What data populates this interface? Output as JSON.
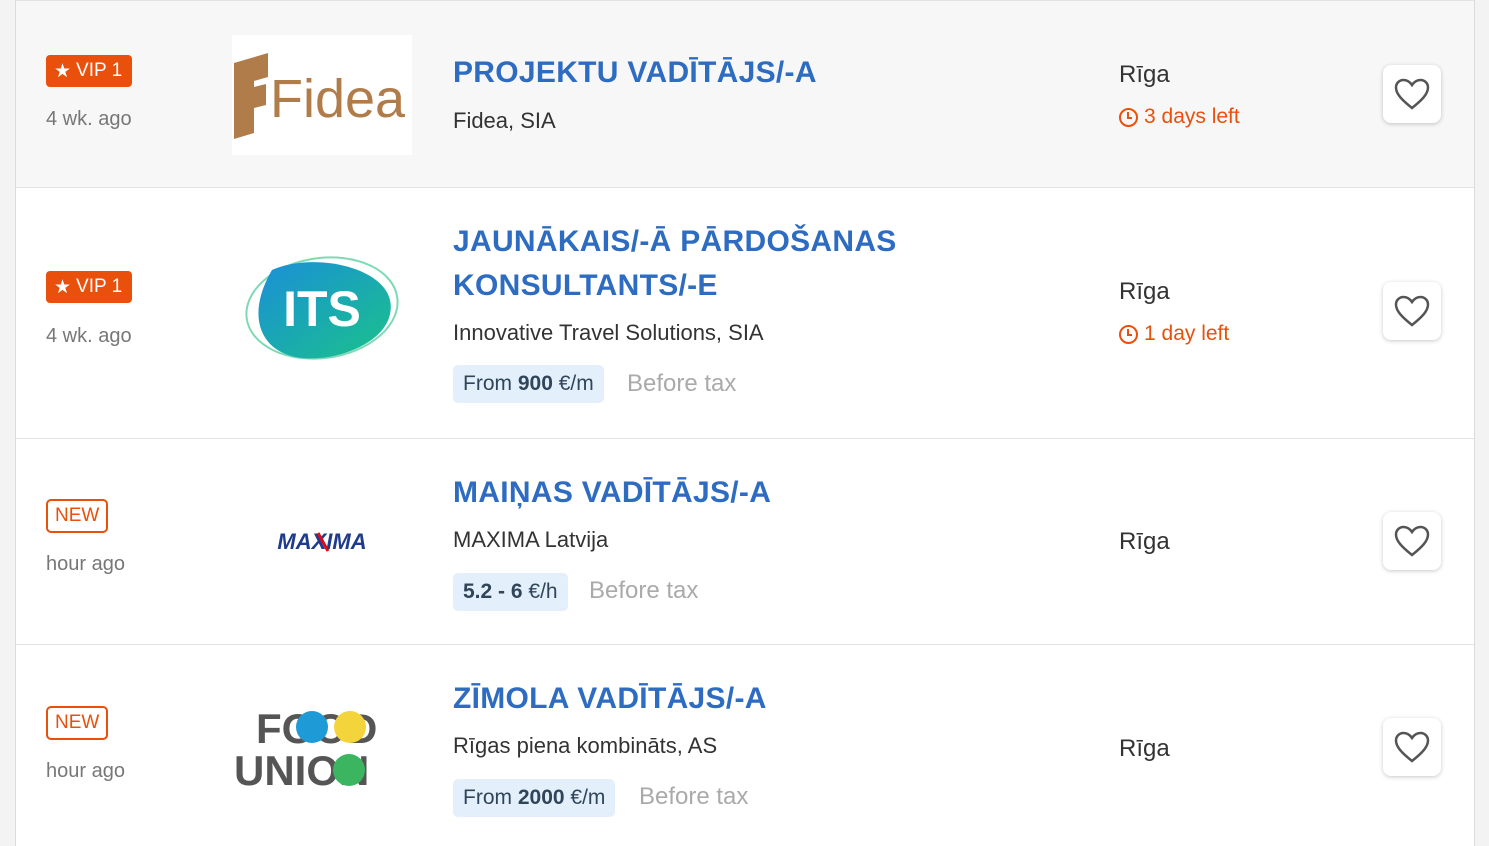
{
  "colors": {
    "accent": "#e8500c",
    "title": "#2d6cc0",
    "salary_bg": "#e3f0fb"
  },
  "jobs": [
    {
      "badge": "VIP 1",
      "badge_icon": "star-icon",
      "posted": "4 wk. ago",
      "logo_text": "Fidea",
      "title": "PROJEKTU VADĪTĀJS/-A",
      "company": "Fidea, SIA",
      "city": "Rīga",
      "deadline": "3 days left"
    },
    {
      "badge": "VIP 1",
      "badge_icon": "star-icon",
      "posted": "4 wk. ago",
      "logo_text": "ITS",
      "title": "JAUNĀKAIS/-Ā PĀRDOŠANAS KONSULTANTS/-E",
      "company": "Innovative Travel Solutions, SIA",
      "salary_prefix": "From",
      "salary_value": "900",
      "salary_unit": "€/m",
      "tax_note": "Before tax",
      "city": "Rīga",
      "deadline": "1 day left"
    },
    {
      "badge": "NEW",
      "posted": "hour ago",
      "logo_text": "MAXIMA",
      "title": "MAIŅAS VADĪTĀJS/-A",
      "company": "MAXIMA Latvija",
      "salary_value": "5.2 - 6",
      "salary_unit": "€/h",
      "tax_note": "Before tax",
      "city": "Rīga"
    },
    {
      "badge": "NEW",
      "posted": "hour ago",
      "logo_text_top": "FOOD",
      "logo_text_bottom": "UNION",
      "title": "ZĪMOLA VADĪTĀJS/-A",
      "company": "Rīgas piena kombināts, AS",
      "salary_prefix": "From",
      "salary_value": "2000",
      "salary_unit": "€/m",
      "tax_note": "Before tax",
      "city": "Rīga"
    }
  ]
}
